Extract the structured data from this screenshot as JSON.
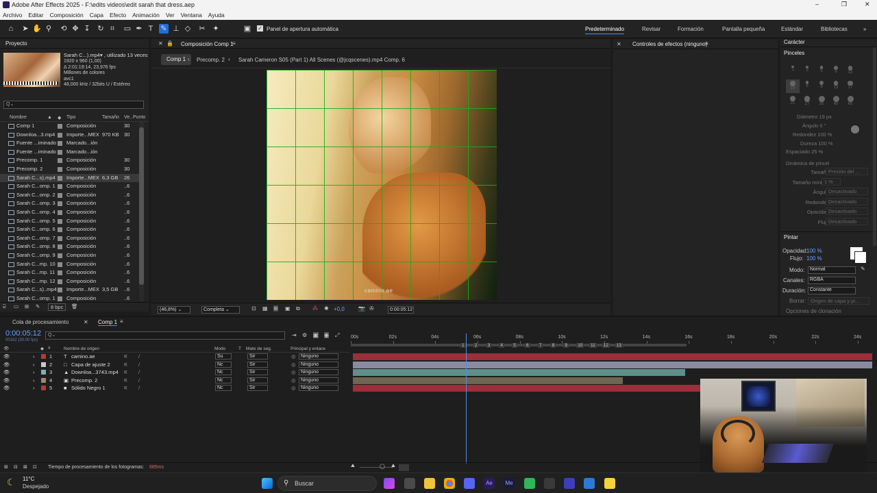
{
  "window": {
    "title": "Adobe After Effects 2025 - F:\\edits videos\\edit sarah that dress.aep",
    "controls": [
      "–",
      "❐",
      "✕"
    ]
  },
  "menu": [
    "Archivo",
    "Editar",
    "Composición",
    "Capa",
    "Efecto",
    "Animación",
    "Ver",
    "Ventana",
    "Ayuda"
  ],
  "toolbar": {
    "auto_open_label": "Panel de apertura automática",
    "workspaces": [
      "Predeterminado",
      "Revisar",
      "Formación",
      "Pantalla pequeña",
      "Estándar",
      "Bibliotecas"
    ],
    "more": "»"
  },
  "project": {
    "title": "Proyecto",
    "asset_name": "Sarah C...).mp4▾ , utilizado 13 veces",
    "asset_info": [
      "1920 x 960 (1,00)",
      "Δ 2:01:19:14, 23,976 fps",
      "Millones de colores",
      "avc1",
      "48,000 kHz / 32bits U / Estéreo"
    ],
    "search_placeholder": "Q⌄",
    "columns": [
      "Nombre",
      "Tipo",
      "Tamaño",
      "Ve..",
      "Punto"
    ],
    "items": [
      {
        "name": "Comp 1",
        "type": "Composición",
        "size": "",
        "fr": "30",
        "color": "#8c8c8c"
      },
      {
        "name": "Downloa...3.mp4",
        "type": "Importe...MEX",
        "size": "970 KB",
        "fr": "30",
        "color": "#8c8c8c"
      },
      {
        "name": "Fuente ...iminado",
        "type": "Marcado...ión",
        "size": "",
        "fr": "",
        "color": "#8c8c8c"
      },
      {
        "name": "Fuente ...iminado",
        "type": "Marcado...ión",
        "size": "",
        "fr": "",
        "color": "#8c8c8c"
      },
      {
        "name": "Precomp. 1",
        "type": "Composición",
        "size": "",
        "fr": "30",
        "color": "#8c8c8c"
      },
      {
        "name": "Precomp. 2",
        "type": "Composición",
        "size": "",
        "fr": "30",
        "color": "#8c8c8c"
      },
      {
        "name": "Sarah C...s).mp4",
        "type": "Importe...MEX",
        "size": "6,3 GB",
        "fr": "26",
        "color": "#8c8c8c"
      },
      {
        "name": "Sarah C...omp. 1",
        "type": "Composición",
        "size": "",
        "fr": "..6",
        "color": "#8c8c8c"
      },
      {
        "name": "Sarah C...omp. 2",
        "type": "Composición",
        "size": "",
        "fr": "..6",
        "color": "#8c8c8c"
      },
      {
        "name": "Sarah C...omp. 3",
        "type": "Composición",
        "size": "",
        "fr": "..6",
        "color": "#8c8c8c"
      },
      {
        "name": "Sarah C...omp. 4",
        "type": "Composición",
        "size": "",
        "fr": "..6",
        "color": "#8c8c8c"
      },
      {
        "name": "Sarah C...omp. 5",
        "type": "Composición",
        "size": "",
        "fr": "..6",
        "color": "#8c8c8c"
      },
      {
        "name": "Sarah C...omp. 6",
        "type": "Composición",
        "size": "",
        "fr": "..6",
        "color": "#8c8c8c"
      },
      {
        "name": "Sarah C...omp. 7",
        "type": "Composición",
        "size": "",
        "fr": "..6",
        "color": "#8c8c8c"
      },
      {
        "name": "Sarah C...omp. 8",
        "type": "Composición",
        "size": "",
        "fr": "..6",
        "color": "#8c8c8c"
      },
      {
        "name": "Sarah C...omp. 9",
        "type": "Composición",
        "size": "",
        "fr": "..6",
        "color": "#8c8c8c"
      },
      {
        "name": "Sarah C...mp. 10",
        "type": "Composición",
        "size": "",
        "fr": "..6",
        "color": "#8c8c8c"
      },
      {
        "name": "Sarah C...mp. 11",
        "type": "Composición",
        "size": "",
        "fr": "..6",
        "color": "#8c8c8c"
      },
      {
        "name": "Sarah C...mp. 12",
        "type": "Composición",
        "size": "",
        "fr": "..6",
        "color": "#8c8c8c"
      },
      {
        "name": "Sarah C...s)..mp4",
        "type": "Importe...MEX",
        "size": "3,5 GB",
        "fr": "..6",
        "color": "#8c8c8c"
      },
      {
        "name": "Sarah C...omp. 1",
        "type": "Composición",
        "size": "",
        "fr": "..6",
        "color": "#8c8c8c"
      }
    ],
    "bpc": "8 bpc"
  },
  "comp": {
    "title": "Composición Comp 1",
    "breadcrumbs": [
      "Comp 1",
      "Precomp. 2",
      "Sarah Cameron S05 (Part 1) All Scenes (@jcqscenes).mp4 Comp. 6"
    ],
    "watermark": "camino.ae",
    "zoom": "(46,8%)",
    "resolution": "Completa",
    "exposure": "+0,0",
    "time": "0:00:05:12"
  },
  "effects": {
    "title": "Controles de efectos (ninguno)"
  },
  "right": {
    "caracter": "Carácter",
    "pinceles": "Pinceles",
    "brush_sizes": [
      "1",
      "3",
      "5",
      "9",
      "13",
      "19",
      "5",
      "9",
      "13",
      "17",
      "21",
      "27",
      "35",
      "45",
      "65"
    ],
    "diametro": "Diámetro 19 px",
    "angulo": "Ángulo 0 °",
    "redondez": "Redondez 100 %",
    "dureza": "Dureza 100 %",
    "espaciado": "Espaciado 25 %",
    "dinamica": "Dinámica de pincel",
    "props": [
      {
        "label": "Tamaño",
        "value": "Presión del ..."
      },
      {
        "label": "Tamaño mínimo",
        "value": "1 %"
      },
      {
        "label": "Ángulo",
        "value": "Desactivado"
      },
      {
        "label": "Redondez",
        "value": "Desactivado"
      },
      {
        "label": "Opacidad",
        "value": "Desactivado"
      },
      {
        "label": "Flujo",
        "value": "Desactivado"
      }
    ],
    "pintar": "Pintar",
    "opacidad_label": "Opacidad:",
    "opacidad": "100 %",
    "flujo_label": "Flujo:",
    "flujo": "100 %",
    "modo_label": "Modo:",
    "modo": "Normal",
    "canales_label": "Canales:",
    "canales": "RGBA",
    "duracion_label": "Duración:",
    "duracion": "Constante",
    "borrar_label": "Borrar:",
    "borrar": "Origen de capa y pi...",
    "clonacion": "Opciones de clonación"
  },
  "timeline": {
    "tabs": [
      "Cola de procesamiento",
      "Comp 1"
    ],
    "timecode": "0:00:05:12",
    "timecode_sub": "00162 (30,00 fps)",
    "search_placeholder": "Q⌄",
    "columns": {
      "source": "Nombre de origen",
      "mode": "Modo",
      "t": "T",
      "matte": "Mate de seg.",
      "parent": "Principal y enlace"
    },
    "ruler": [
      "00s",
      "02s",
      "04s",
      "06s",
      "08s",
      "10s",
      "12s",
      "14s",
      "16s",
      "18s",
      "20s",
      "22s",
      "24s"
    ],
    "markers": [
      "1",
      "2",
      "3",
      "4",
      "5",
      "6",
      "7",
      "8",
      "9",
      "10",
      "11",
      "12",
      "13"
    ],
    "layers": [
      {
        "num": "1",
        "name": "camino.ae",
        "icon": "T",
        "mode": "Su",
        "matte": "Sir",
        "parent": "Ninguno",
        "label": "#b33a3a",
        "bar_color": "#9b2f3a",
        "bar_len": 1.0
      },
      {
        "num": "2",
        "name": "Capa de ajuste 2",
        "icon": "□",
        "mode": "Nc",
        "matte": "Sir",
        "parent": "Ninguno",
        "label": "#c8c8c8",
        "bar_color": "#8a8aa0",
        "bar_len": 1.0
      },
      {
        "num": "3",
        "name": "Downloa...3743.mp4",
        "icon": "▲",
        "mode": "Nc",
        "matte": "Sir",
        "parent": "Ninguno",
        "label": "#7fb0b8",
        "bar_color": "#5e8f8a",
        "bar_len": 0.64
      },
      {
        "num": "4",
        "name": "Precomp. 2",
        "icon": "▣",
        "mode": "Nc",
        "matte": "Sir",
        "parent": "Ninguno",
        "label": "#a08a6a",
        "bar_color": "#6f6651",
        "bar_len": 0.52
      },
      {
        "num": "5",
        "name": "Sólido Negro 1",
        "icon": "■",
        "mode": "Nc",
        "matte": "Sir",
        "parent": "Ninguno",
        "label": "#b33a3a",
        "bar_color": "#9b2f3a",
        "bar_len": 0.67
      }
    ],
    "playhead": 0.22,
    "footer_label": "Tiempo de procesamiento de los fotogramas:",
    "footer_value": "685ms"
  },
  "taskbar": {
    "weather_temp": "11°C",
    "weather_desc": "Despejado",
    "search": "Buscar"
  }
}
